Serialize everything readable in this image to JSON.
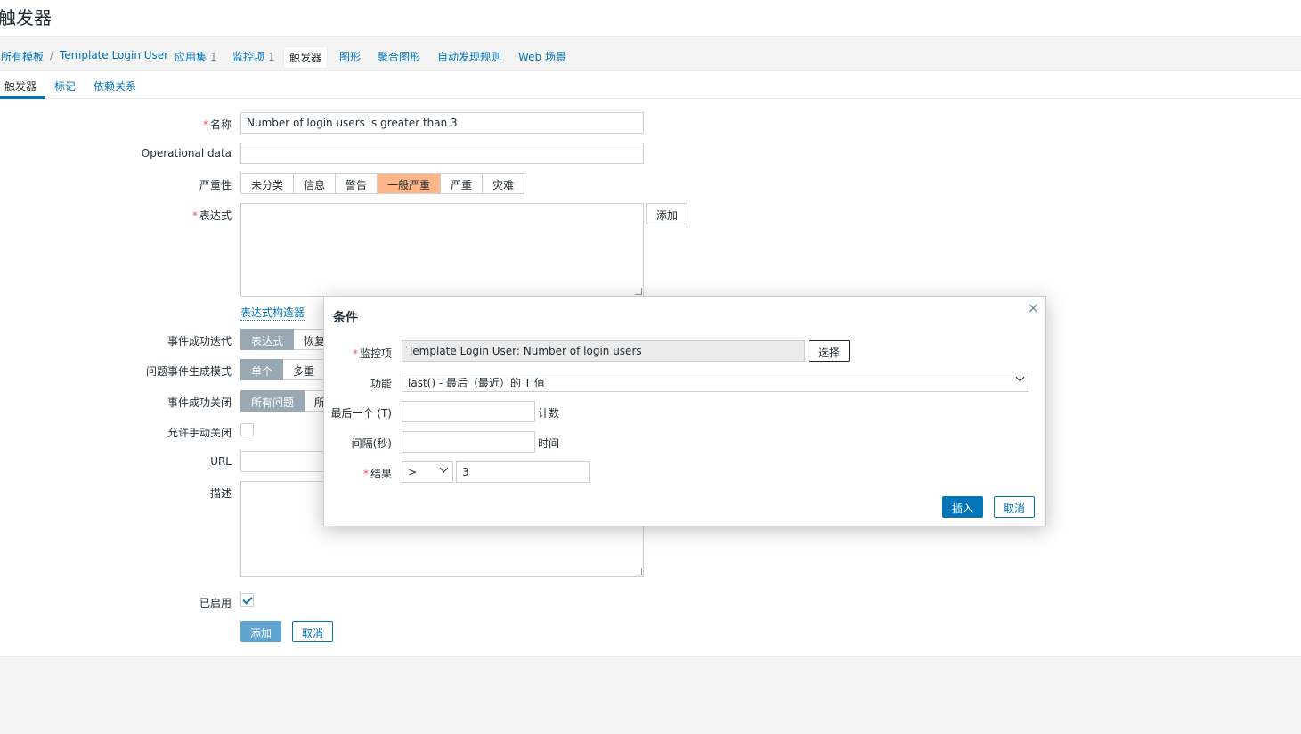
{
  "page": {
    "title": "触发器"
  },
  "breadcrumb": {
    "all_templates": "所有模板",
    "separator": "/",
    "template": "Template Login User",
    "applications": {
      "label": "应用集",
      "count": "1"
    },
    "items": {
      "label": "监控项",
      "count": "1"
    },
    "triggers": "触发器",
    "graphs": "图形",
    "screens": "聚合图形",
    "discovery": "自动发现规则",
    "web": "Web 场景"
  },
  "tabs": [
    "触发器",
    "标记",
    "依赖关系"
  ],
  "form": {
    "name": {
      "label": "名称",
      "value": "Number of login users is greater than 3"
    },
    "opdata": {
      "label": "Operational data",
      "value": ""
    },
    "severity": {
      "label": "严重性",
      "options": [
        "未分类",
        "信息",
        "警告",
        "一般严重",
        "严重",
        "灾难"
      ],
      "selected": "一般严重"
    },
    "expression": {
      "label": "表达式",
      "add_button": "添加",
      "builder_link": "表达式构造器"
    },
    "ok_event": {
      "label": "事件成功迭代",
      "options": [
        "表达式",
        "恢复"
      ]
    },
    "problem_mode": {
      "label": "问题事件生成模式",
      "options": [
        "单个",
        "多重"
      ]
    },
    "ok_close": {
      "label": "事件成功关闭",
      "options": [
        "所有问题",
        "所"
      ]
    },
    "manual_close": {
      "label": "允许手动关闭",
      "checked": false
    },
    "url": {
      "label": "URL",
      "value": ""
    },
    "description": {
      "label": "描述"
    },
    "enabled": {
      "label": "已启用",
      "checked": true
    },
    "add_button": "添加",
    "cancel_button": "取消"
  },
  "dialog": {
    "title": "条件",
    "close": "×",
    "item": {
      "label": "监控项",
      "value": "Template Login User: Number of login users",
      "select_button": "选择"
    },
    "function": {
      "label": "功能",
      "value": "last() - 最后（最近）的 T 值"
    },
    "last_of": {
      "label": "最后一个 (T)",
      "value": "",
      "unit": "计数"
    },
    "interval": {
      "label": "间隔(秒)",
      "value": "",
      "unit": "时间"
    },
    "result": {
      "label": "结果",
      "operator": ">",
      "value": "3"
    },
    "insert_button": "插入",
    "cancel_button": "取消"
  },
  "colors": {
    "accent": "#0275b8",
    "severity_average": "#ffb689",
    "required": "#e45959"
  }
}
